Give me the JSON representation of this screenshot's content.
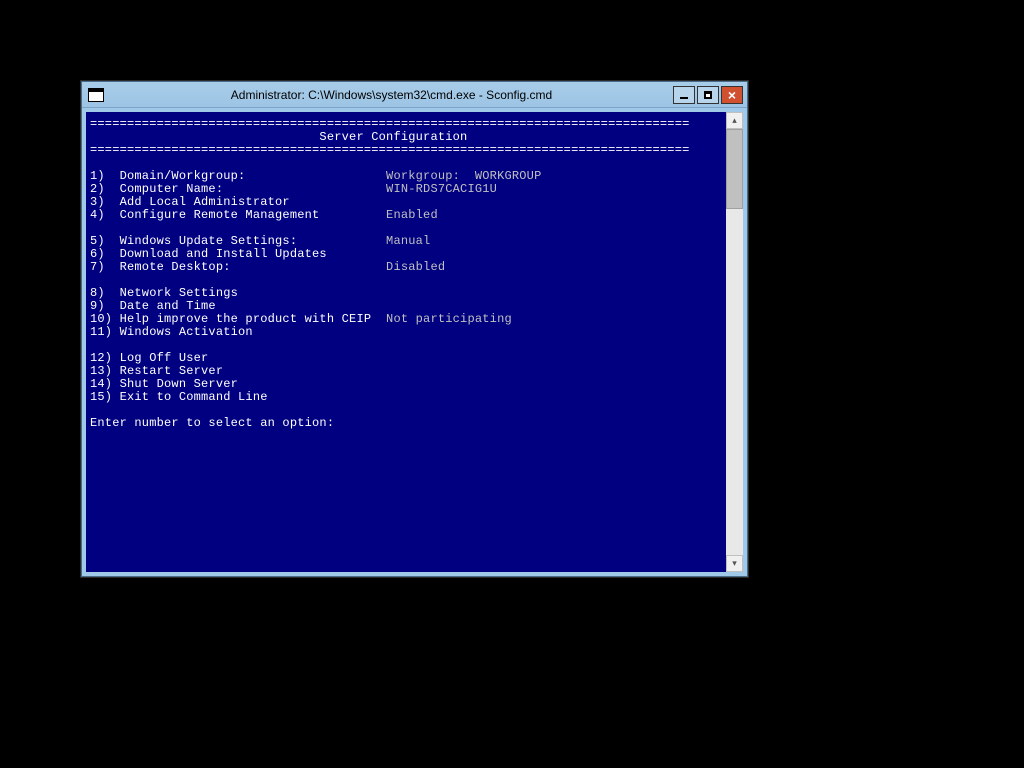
{
  "window_title": "Administrator: C:\\Windows\\system32\\cmd.exe - Sconfig.cmd",
  "header": {
    "bar": "=================================================================================",
    "title": "                               Server Configuration                              "
  },
  "menu": {
    "items": [
      {
        "num": "1)",
        "label": "Domain/Workgroup:",
        "value": "Workgroup:  WORKGROUP"
      },
      {
        "num": "2)",
        "label": "Computer Name:",
        "value": "WIN-RDS7CACIG1U"
      },
      {
        "num": "3)",
        "label": "Add Local Administrator",
        "value": ""
      },
      {
        "num": "4)",
        "label": "Configure Remote Management",
        "value": "Enabled"
      },
      {
        "num": "",
        "label": "",
        "value": ""
      },
      {
        "num": "5)",
        "label": "Windows Update Settings:",
        "value": "Manual"
      },
      {
        "num": "6)",
        "label": "Download and Install Updates",
        "value": ""
      },
      {
        "num": "7)",
        "label": "Remote Desktop:",
        "value": "Disabled"
      },
      {
        "num": "",
        "label": "",
        "value": ""
      },
      {
        "num": "8)",
        "label": "Network Settings",
        "value": ""
      },
      {
        "num": "9)",
        "label": "Date and Time",
        "value": ""
      },
      {
        "num": "10)",
        "label": "Help improve the product with CEIP",
        "value": "Not participating"
      },
      {
        "num": "11)",
        "label": "Windows Activation",
        "value": ""
      },
      {
        "num": "",
        "label": "",
        "value": ""
      },
      {
        "num": "12)",
        "label": "Log Off User",
        "value": ""
      },
      {
        "num": "13)",
        "label": "Restart Server",
        "value": ""
      },
      {
        "num": "14)",
        "label": "Shut Down Server",
        "value": ""
      },
      {
        "num": "15)",
        "label": "Exit to Command Line",
        "value": ""
      }
    ]
  },
  "prompt": "Enter number to select an option: "
}
